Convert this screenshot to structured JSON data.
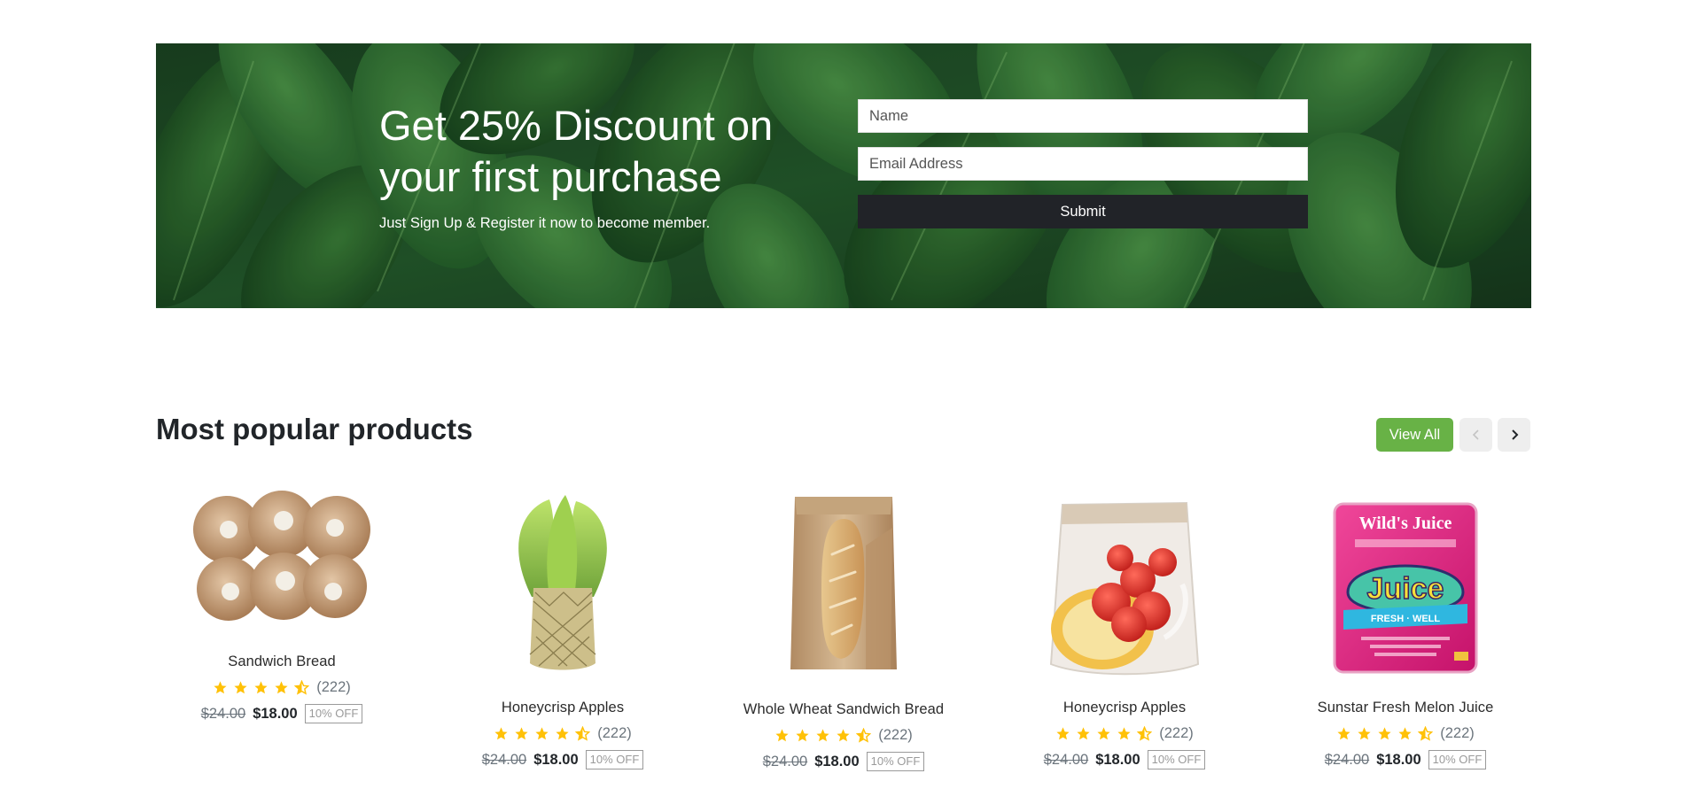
{
  "banner": {
    "title": "Get 25% Discount on\nyour first purchase",
    "subtitle": "Just Sign Up & Register it now to become member.",
    "name_placeholder": "Name",
    "email_placeholder": "Email Address",
    "submit_label": "Submit"
  },
  "section": {
    "title": "Most popular products",
    "view_all_label": "View All",
    "prev_icon": "chevron-left-icon",
    "next_icon": "chevron-right-icon"
  },
  "products": [
    {
      "name": "Sandwich Bread",
      "rating_count": "(222)",
      "old_price": "$24.00",
      "price": "$18.00",
      "discount": "10% OFF",
      "rating": 4.5
    },
    {
      "name": "Honeycrisp Apples",
      "rating_count": "(222)",
      "old_price": "$24.00",
      "price": "$18.00",
      "discount": "10% OFF",
      "rating": 4.5
    },
    {
      "name": "Whole Wheat Sandwich Bread",
      "rating_count": "(222)",
      "old_price": "$24.00",
      "price": "$18.00",
      "discount": "10% OFF",
      "rating": 4.5
    },
    {
      "name": "Honeycrisp Apples",
      "rating_count": "(222)",
      "old_price": "$24.00",
      "price": "$18.00",
      "discount": "10% OFF",
      "rating": 4.5
    },
    {
      "name": "Sunstar Fresh Melon Juice",
      "rating_count": "(222)",
      "old_price": "$24.00",
      "price": "$18.00",
      "discount": "10% OFF",
      "rating": 4.5
    }
  ],
  "juice_pack_text": {
    "brand": "Wild's Juice",
    "big": "Juice",
    "ribbon": "FRESH · WELL"
  },
  "colors": {
    "accent_green": "#68b246",
    "star": "#ffc107",
    "dark_button": "#212328"
  }
}
